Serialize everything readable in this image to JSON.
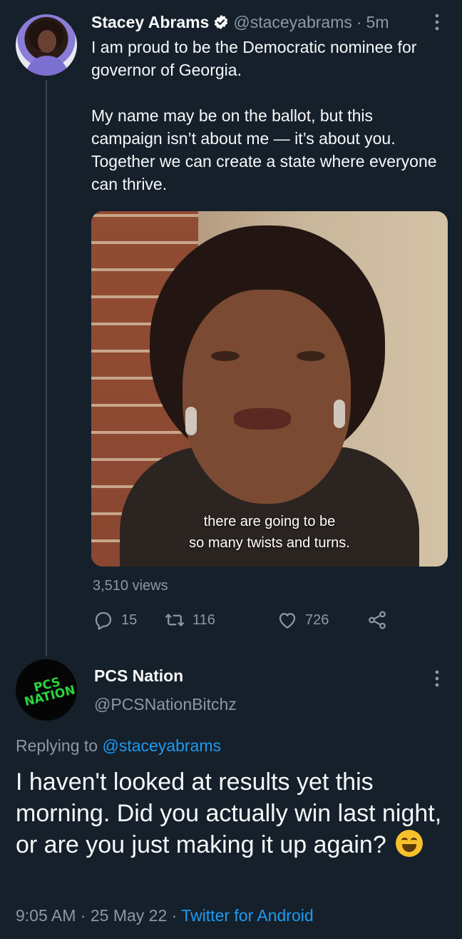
{
  "tweet": {
    "author_name": "Stacey Abrams",
    "handle": "@staceyabrams",
    "separator": "·",
    "time": "5m",
    "text_p1": "I am proud to be the Democratic nominee for governor of Georgia.",
    "text_p2": "My name may be on the ballot, but this campaign isn’t about me — it’s about you. Together we can create a state where everyone can thrive.",
    "video_caption_line1": "there are going to be",
    "video_caption_line2": "so many twists and turns.",
    "views": "3,510 views",
    "replies": "15",
    "retweets": "116",
    "likes": "726"
  },
  "reply": {
    "author_name": "PCS Nation",
    "handle": "@PCSNationBitchz",
    "avatar_text_line1": "PCS",
    "avatar_text_line2": "NATION",
    "replying_prefix": "Replying to",
    "replying_mention": "@staceyabrams",
    "text": "I haven't looked at results yet this morning. Did you actually win last night, or are you just making it up again?",
    "time": "9:05 AM",
    "date": "25 May 22",
    "source": "Twitter for Android",
    "separator": "·"
  },
  "colors": {
    "background": "#15202b",
    "primary_text": "#f7f9f9",
    "secondary_text": "#8b98a5",
    "accent": "#1d9bf0",
    "thread_line": "#38444d"
  },
  "icons": [
    "verified-badge-icon",
    "more-options-icon",
    "reply-icon",
    "retweet-icon",
    "like-icon",
    "share-icon",
    "grinning-emoji"
  ]
}
